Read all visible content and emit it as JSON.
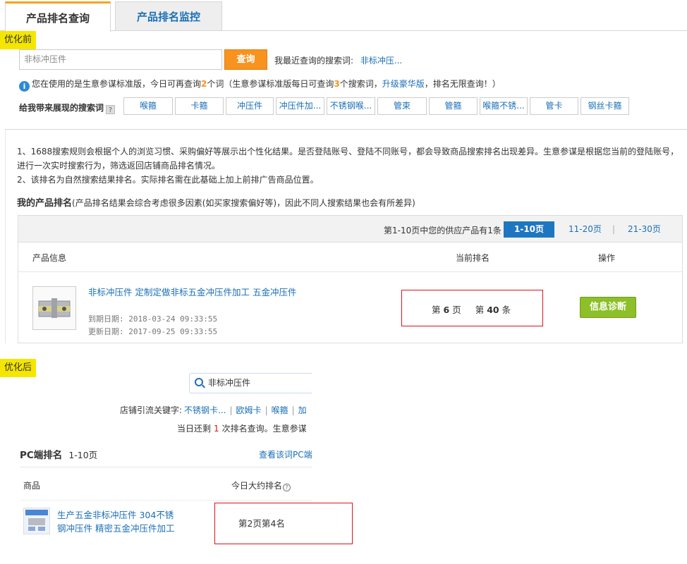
{
  "before": {
    "tag": "优化前",
    "tabs": [
      "产品排名查询",
      "产品排名监控"
    ],
    "search_value": "非标冲压件",
    "search_button": "查询",
    "recent_label": "我最近查询的搜索词:",
    "recent_value": "非标冲压...",
    "info": {
      "part1": "您在使用的是生意参谋标准版，今日可再查询",
      "count1": "2",
      "part2": "个词（生意参谋标准版每日可查询",
      "count2": "3",
      "part3": "个搜索词，",
      "upgrade_link": "升级豪华版",
      "part4": "，排名无限查询！）"
    },
    "keywords_label": "给我带来展现的搜索词",
    "keywords": [
      "喉箍",
      "卡箍",
      "冲压件",
      "冲压件加...",
      "不锈钢喉...",
      "管束",
      "管箍",
      "喉箍不锈...",
      "管卡",
      "钢丝卡箍"
    ],
    "notes": [
      "1、1688搜索规则会根据个人的浏览习惯、采购偏好等展示出个性化结果。是否登陆账号、登陆不同账号，都会导致商品搜索排名出现差异。生意参谋是根据您当前的登陆账号，进行一次实时搜索行为，筛选返回店铺商品排名情况。",
      "2、该排名为自然搜索结果排名。实际排名需在此基础上加上前排广告商品位置。"
    ],
    "my_rank_title": "我的产品排名",
    "my_rank_note": "(产品排名结果会综合考虑很多因素(如买家搜索偏好等)，因此不同人搜索结果也会有所差异)",
    "summary": "第1-10页中您的供应产品有1条",
    "pages": [
      "1-10页",
      "11-20页",
      "21-30页"
    ],
    "columns": [
      "产品信息",
      "当前排名",
      "操作"
    ],
    "product": {
      "title": "非标冲压件 定制定做非标五金冲压件加工 五金冲压件",
      "expire_label": "到期日期:",
      "expire": "2018-03-24 09:33:55",
      "update_label": "更新日期:",
      "update": "2017-09-25 09:33:55",
      "rank_page_prefix": "第",
      "rank_page": "6",
      "rank_page_suffix": "页",
      "rank_item_prefix": "第",
      "rank_item": "40",
      "rank_item_suffix": "条",
      "action": "信息诊断"
    }
  },
  "after": {
    "tag": "优化后",
    "search_value": "非标冲压件",
    "shop_keywords_label": "店铺引流关键字:",
    "shop_keywords": [
      "不锈钢卡...",
      "欧姆卡",
      "喉箍",
      "加"
    ],
    "remain_prefix": "当日还剩",
    "remain_count": "1",
    "remain_suffix": "次排名查询。生意参谋",
    "pc_rank_title": "PC端排名",
    "pc_rank_pages": "1-10页",
    "view_link": "查看该词PC端",
    "col_product": "商品",
    "col_rank": "今日大约排名",
    "product_title_line1": "生产五金非标冲压件 304不锈",
    "product_title_line2": "钢冲压件 精密五金冲压件加工",
    "rank_text": "第2页第4名"
  },
  "colors": {
    "accent_orange": "#f7931e",
    "link_blue": "#1a6fb6",
    "highlight_red": "#d9141b",
    "tag_yellow": "#f5e600",
    "diag_green": "#8dbf28"
  }
}
